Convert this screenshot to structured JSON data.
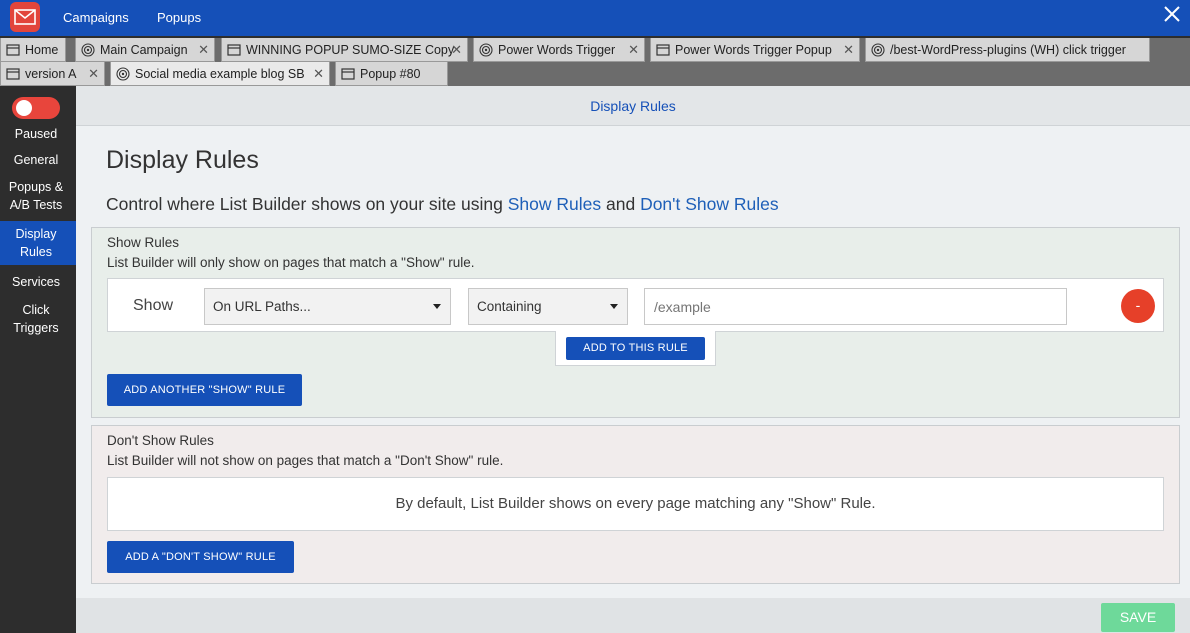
{
  "topbar": {
    "nav_campaigns": "Campaigns",
    "nav_popups": "Popups"
  },
  "tabs_row1": [
    {
      "label": "Home",
      "icon": "window-icon"
    },
    {
      "label": "Main Campaign",
      "icon": "target-icon"
    },
    {
      "label": "WINNING POPUP SUMO-SIZE Copy",
      "icon": "window-icon"
    },
    {
      "label": "Power Words Trigger",
      "icon": "target-icon"
    },
    {
      "label": "Power Words Trigger Popup",
      "icon": "window-icon"
    },
    {
      "label": "/best-WordPress-plugins (WH) click trigger",
      "icon": "target-icon"
    }
  ],
  "tabs_row2": [
    {
      "label": "version A",
      "icon": "window-icon"
    },
    {
      "label": "Social media example blog SB",
      "icon": "target-icon",
      "active": true
    },
    {
      "label": "Popup #80",
      "icon": "window-icon"
    }
  ],
  "sidebar": {
    "status": "Paused",
    "items": [
      {
        "label_line1": "General",
        "label_line2": ""
      },
      {
        "label_line1": "Popups &",
        "label_line2": "A/B Tests"
      },
      {
        "label_line1": "Display",
        "label_line2": "Rules"
      },
      {
        "label_line1": "Services",
        "label_line2": ""
      },
      {
        "label_line1": "Click",
        "label_line2": "Triggers"
      }
    ]
  },
  "main": {
    "header": "Display Rules",
    "title": "Display Rules",
    "subtitle_prefix": "Control where List Builder shows on your site using ",
    "subtitle_link1": "Show Rules",
    "subtitle_and": " and ",
    "subtitle_link2": "Don't Show Rules"
  },
  "show_rules": {
    "title": "Show Rules",
    "description": "List Builder will only show on pages that match a \"Show\" rule.",
    "rule": {
      "label": "Show",
      "condition": "On URL Paths...",
      "operator": "Containing",
      "value_placeholder": "/example",
      "remove_label": "-"
    },
    "add_to_rule_label": "ADD TO THIS RULE",
    "add_another_label": "ADD ANOTHER \"SHOW\" RULE"
  },
  "dont_show_rules": {
    "title": "Don't Show Rules",
    "description": "List Builder will not show on pages that match a \"Don't Show\" rule.",
    "default_text": "By default, List Builder shows on every page matching any \"Show\" Rule.",
    "add_label": "ADD A \"DON'T SHOW\" RULE"
  },
  "save_label": "SAVE",
  "colors": {
    "brand_blue": "#1550b8",
    "toggle_red": "#e8453c",
    "save_green": "#6ed99a"
  }
}
